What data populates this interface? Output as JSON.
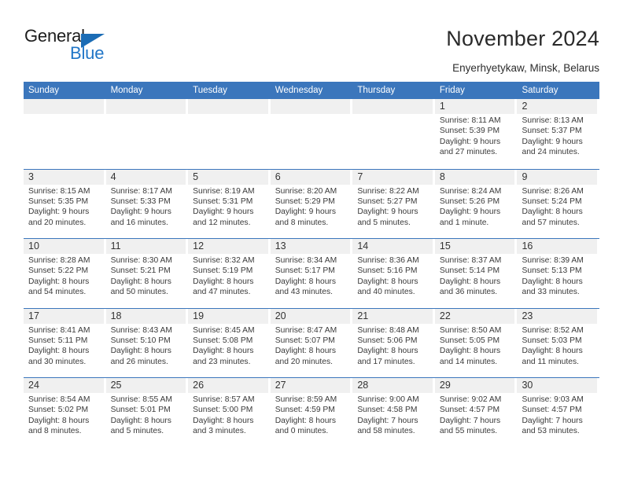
{
  "brand": {
    "line1": "General",
    "line2": "Blue",
    "accent_color": "#1b6cb5"
  },
  "header": {
    "title": "November 2024",
    "subtitle": "Enyerhyetykaw, Minsk, Belarus"
  },
  "colors": {
    "header_blue": "#3b76bc",
    "day_band_gray": "#f0f0f0",
    "text": "#3a3a3a"
  },
  "weekdays": [
    "Sunday",
    "Monday",
    "Tuesday",
    "Wednesday",
    "Thursday",
    "Friday",
    "Saturday"
  ],
  "weeks": [
    [
      {
        "day": "",
        "sunrise": "",
        "sunset": "",
        "daylight1": "",
        "daylight2": ""
      },
      {
        "day": "",
        "sunrise": "",
        "sunset": "",
        "daylight1": "",
        "daylight2": ""
      },
      {
        "day": "",
        "sunrise": "",
        "sunset": "",
        "daylight1": "",
        "daylight2": ""
      },
      {
        "day": "",
        "sunrise": "",
        "sunset": "",
        "daylight1": "",
        "daylight2": ""
      },
      {
        "day": "",
        "sunrise": "",
        "sunset": "",
        "daylight1": "",
        "daylight2": ""
      },
      {
        "day": "1",
        "sunrise": "Sunrise: 8:11 AM",
        "sunset": "Sunset: 5:39 PM",
        "daylight1": "Daylight: 9 hours",
        "daylight2": "and 27 minutes."
      },
      {
        "day": "2",
        "sunrise": "Sunrise: 8:13 AM",
        "sunset": "Sunset: 5:37 PM",
        "daylight1": "Daylight: 9 hours",
        "daylight2": "and 24 minutes."
      }
    ],
    [
      {
        "day": "3",
        "sunrise": "Sunrise: 8:15 AM",
        "sunset": "Sunset: 5:35 PM",
        "daylight1": "Daylight: 9 hours",
        "daylight2": "and 20 minutes."
      },
      {
        "day": "4",
        "sunrise": "Sunrise: 8:17 AM",
        "sunset": "Sunset: 5:33 PM",
        "daylight1": "Daylight: 9 hours",
        "daylight2": "and 16 minutes."
      },
      {
        "day": "5",
        "sunrise": "Sunrise: 8:19 AM",
        "sunset": "Sunset: 5:31 PM",
        "daylight1": "Daylight: 9 hours",
        "daylight2": "and 12 minutes."
      },
      {
        "day": "6",
        "sunrise": "Sunrise: 8:20 AM",
        "sunset": "Sunset: 5:29 PM",
        "daylight1": "Daylight: 9 hours",
        "daylight2": "and 8 minutes."
      },
      {
        "day": "7",
        "sunrise": "Sunrise: 8:22 AM",
        "sunset": "Sunset: 5:27 PM",
        "daylight1": "Daylight: 9 hours",
        "daylight2": "and 5 minutes."
      },
      {
        "day": "8",
        "sunrise": "Sunrise: 8:24 AM",
        "sunset": "Sunset: 5:26 PM",
        "daylight1": "Daylight: 9 hours",
        "daylight2": "and 1 minute."
      },
      {
        "day": "9",
        "sunrise": "Sunrise: 8:26 AM",
        "sunset": "Sunset: 5:24 PM",
        "daylight1": "Daylight: 8 hours",
        "daylight2": "and 57 minutes."
      }
    ],
    [
      {
        "day": "10",
        "sunrise": "Sunrise: 8:28 AM",
        "sunset": "Sunset: 5:22 PM",
        "daylight1": "Daylight: 8 hours",
        "daylight2": "and 54 minutes."
      },
      {
        "day": "11",
        "sunrise": "Sunrise: 8:30 AM",
        "sunset": "Sunset: 5:21 PM",
        "daylight1": "Daylight: 8 hours",
        "daylight2": "and 50 minutes."
      },
      {
        "day": "12",
        "sunrise": "Sunrise: 8:32 AM",
        "sunset": "Sunset: 5:19 PM",
        "daylight1": "Daylight: 8 hours",
        "daylight2": "and 47 minutes."
      },
      {
        "day": "13",
        "sunrise": "Sunrise: 8:34 AM",
        "sunset": "Sunset: 5:17 PM",
        "daylight1": "Daylight: 8 hours",
        "daylight2": "and 43 minutes."
      },
      {
        "day": "14",
        "sunrise": "Sunrise: 8:36 AM",
        "sunset": "Sunset: 5:16 PM",
        "daylight1": "Daylight: 8 hours",
        "daylight2": "and 40 minutes."
      },
      {
        "day": "15",
        "sunrise": "Sunrise: 8:37 AM",
        "sunset": "Sunset: 5:14 PM",
        "daylight1": "Daylight: 8 hours",
        "daylight2": "and 36 minutes."
      },
      {
        "day": "16",
        "sunrise": "Sunrise: 8:39 AM",
        "sunset": "Sunset: 5:13 PM",
        "daylight1": "Daylight: 8 hours",
        "daylight2": "and 33 minutes."
      }
    ],
    [
      {
        "day": "17",
        "sunrise": "Sunrise: 8:41 AM",
        "sunset": "Sunset: 5:11 PM",
        "daylight1": "Daylight: 8 hours",
        "daylight2": "and 30 minutes."
      },
      {
        "day": "18",
        "sunrise": "Sunrise: 8:43 AM",
        "sunset": "Sunset: 5:10 PM",
        "daylight1": "Daylight: 8 hours",
        "daylight2": "and 26 minutes."
      },
      {
        "day": "19",
        "sunrise": "Sunrise: 8:45 AM",
        "sunset": "Sunset: 5:08 PM",
        "daylight1": "Daylight: 8 hours",
        "daylight2": "and 23 minutes."
      },
      {
        "day": "20",
        "sunrise": "Sunrise: 8:47 AM",
        "sunset": "Sunset: 5:07 PM",
        "daylight1": "Daylight: 8 hours",
        "daylight2": "and 20 minutes."
      },
      {
        "day": "21",
        "sunrise": "Sunrise: 8:48 AM",
        "sunset": "Sunset: 5:06 PM",
        "daylight1": "Daylight: 8 hours",
        "daylight2": "and 17 minutes."
      },
      {
        "day": "22",
        "sunrise": "Sunrise: 8:50 AM",
        "sunset": "Sunset: 5:05 PM",
        "daylight1": "Daylight: 8 hours",
        "daylight2": "and 14 minutes."
      },
      {
        "day": "23",
        "sunrise": "Sunrise: 8:52 AM",
        "sunset": "Sunset: 5:03 PM",
        "daylight1": "Daylight: 8 hours",
        "daylight2": "and 11 minutes."
      }
    ],
    [
      {
        "day": "24",
        "sunrise": "Sunrise: 8:54 AM",
        "sunset": "Sunset: 5:02 PM",
        "daylight1": "Daylight: 8 hours",
        "daylight2": "and 8 minutes."
      },
      {
        "day": "25",
        "sunrise": "Sunrise: 8:55 AM",
        "sunset": "Sunset: 5:01 PM",
        "daylight1": "Daylight: 8 hours",
        "daylight2": "and 5 minutes."
      },
      {
        "day": "26",
        "sunrise": "Sunrise: 8:57 AM",
        "sunset": "Sunset: 5:00 PM",
        "daylight1": "Daylight: 8 hours",
        "daylight2": "and 3 minutes."
      },
      {
        "day": "27",
        "sunrise": "Sunrise: 8:59 AM",
        "sunset": "Sunset: 4:59 PM",
        "daylight1": "Daylight: 8 hours",
        "daylight2": "and 0 minutes."
      },
      {
        "day": "28",
        "sunrise": "Sunrise: 9:00 AM",
        "sunset": "Sunset: 4:58 PM",
        "daylight1": "Daylight: 7 hours",
        "daylight2": "and 58 minutes."
      },
      {
        "day": "29",
        "sunrise": "Sunrise: 9:02 AM",
        "sunset": "Sunset: 4:57 PM",
        "daylight1": "Daylight: 7 hours",
        "daylight2": "and 55 minutes."
      },
      {
        "day": "30",
        "sunrise": "Sunrise: 9:03 AM",
        "sunset": "Sunset: 4:57 PM",
        "daylight1": "Daylight: 7 hours",
        "daylight2": "and 53 minutes."
      }
    ]
  ]
}
